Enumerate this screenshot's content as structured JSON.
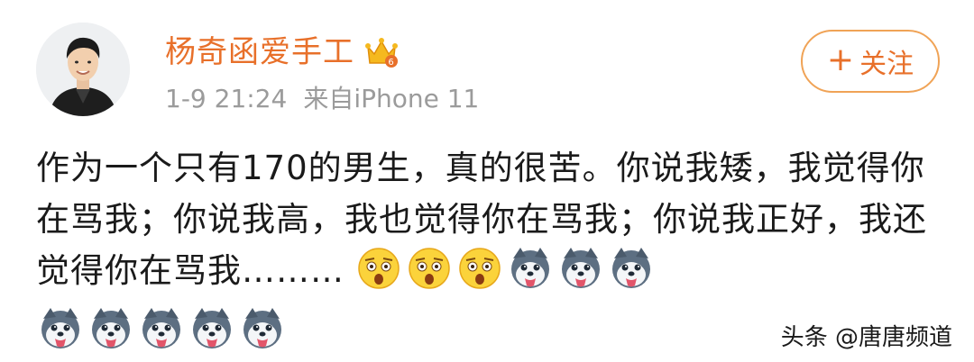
{
  "user": {
    "name": "杨奇函爱手工",
    "time": "1-9 21:24",
    "source": "来自iPhone 11",
    "badge_icon": "crown-icon"
  },
  "follow": {
    "plus": "+",
    "label": "关注"
  },
  "post": {
    "text": "作为一个只有170的男生，真的很苦。你说我矮，我觉得你在骂我；你说我高，我也觉得你在骂我；你说我正好，我还觉得你在骂我………",
    "emojis_line1": [
      "shocked-emoji",
      "shocked-emoji",
      "shocked-emoji",
      "husky-dog-emoji",
      "husky-dog-emoji",
      "husky-dog-emoji"
    ],
    "emojis_line2": [
      "husky-dog-emoji",
      "husky-dog-emoji",
      "husky-dog-emoji",
      "husky-dog-emoji",
      "husky-dog-emoji"
    ]
  },
  "watermark": "头条 @唐唐频道",
  "colors": {
    "accent": "#e8702a",
    "follow_border": "#f0a356",
    "meta": "#9b9b9b"
  }
}
